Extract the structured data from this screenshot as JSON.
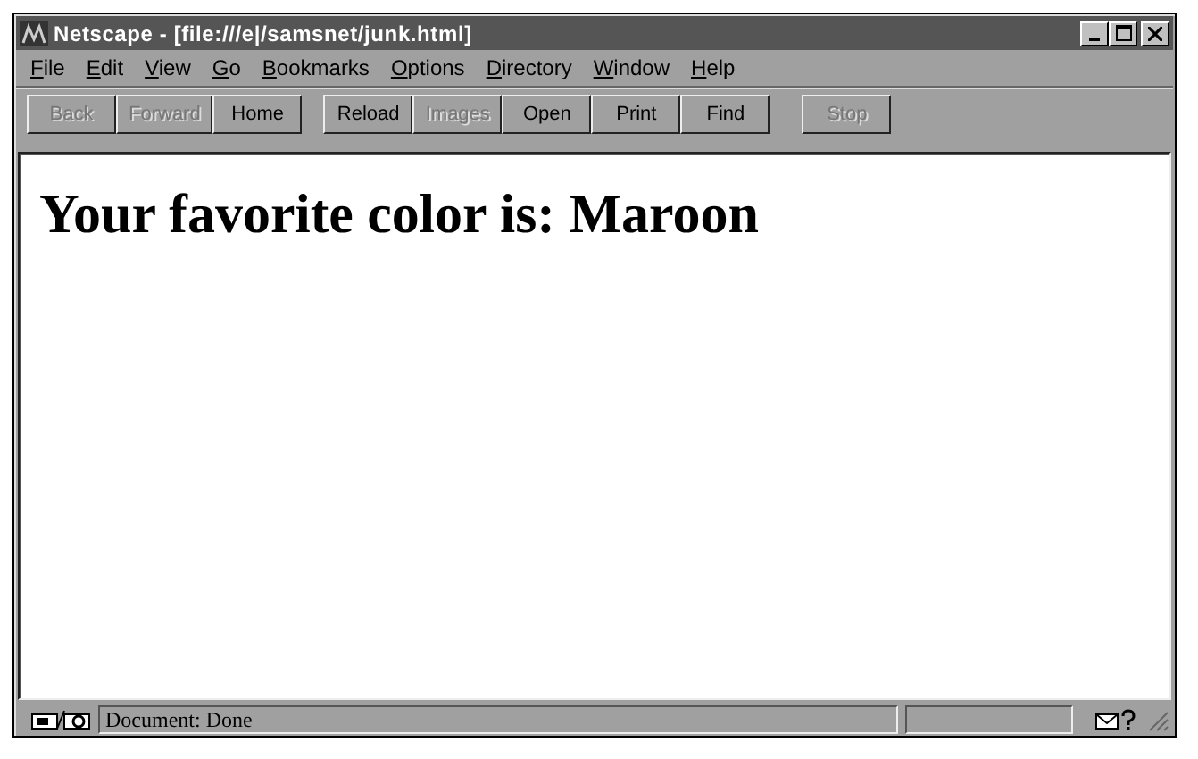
{
  "window": {
    "title": "Netscape - [file:///e|/samsnet/junk.html]"
  },
  "menu": [
    "File",
    "Edit",
    "View",
    "Go",
    "Bookmarks",
    "Options",
    "Directory",
    "Window",
    "Help"
  ],
  "toolbar_groups": [
    [
      {
        "label": "Back",
        "disabled": true
      },
      {
        "label": "Forward",
        "disabled": true
      },
      {
        "label": "Home",
        "disabled": false
      }
    ],
    [
      {
        "label": "Reload",
        "disabled": false
      },
      {
        "label": "Images",
        "disabled": true
      },
      {
        "label": "Open",
        "disabled": false
      },
      {
        "label": "Print",
        "disabled": false
      },
      {
        "label": "Find",
        "disabled": false
      }
    ],
    [
      {
        "label": "Stop",
        "disabled": true
      }
    ]
  ],
  "page": {
    "heading": "Your favorite color is: Maroon"
  },
  "status_bar": {
    "message": "Document: Done"
  }
}
